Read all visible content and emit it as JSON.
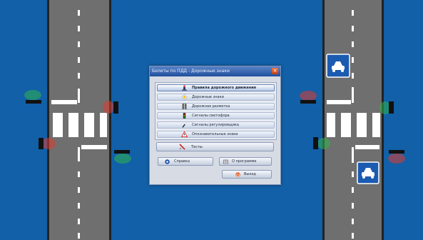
{
  "window": {
    "title": "Билеты по ПДД - Дорожные знаки",
    "close_icon": "close-icon"
  },
  "menu": {
    "items": [
      {
        "label": "Правила дорожного движения",
        "icon": "traffic-police-icon",
        "selected": true
      },
      {
        "label": "Дорожные знаки",
        "icon": "priority-road-sign-icon",
        "selected": false
      },
      {
        "label": "Дорожная разметка",
        "icon": "road-marking-icon",
        "selected": false
      },
      {
        "label": "Сигналы светофора",
        "icon": "traffic-light-icon",
        "selected": false
      },
      {
        "label": "Сигналы регулировщика",
        "icon": "baton-icon",
        "selected": false
      },
      {
        "label": "Опознавательные знаки",
        "icon": "warning-triangle-icon",
        "selected": false
      }
    ]
  },
  "tests": {
    "label": "Тесты",
    "icon": "test-icon"
  },
  "buttons": {
    "help": {
      "label": "Справка",
      "icon": "help-icon"
    },
    "about": {
      "label": "О программе",
      "icon": "about-icon"
    },
    "exit": {
      "label": "Выход",
      "icon": "exit-icon"
    }
  },
  "colors": {
    "background": "#1260a8",
    "road": "#6f6f6f",
    "curb": "#222222",
    "marking": "#ffffff",
    "sign": "#1b5bb0",
    "signal_red": "#e03a2c",
    "signal_green": "#2fb24b"
  }
}
